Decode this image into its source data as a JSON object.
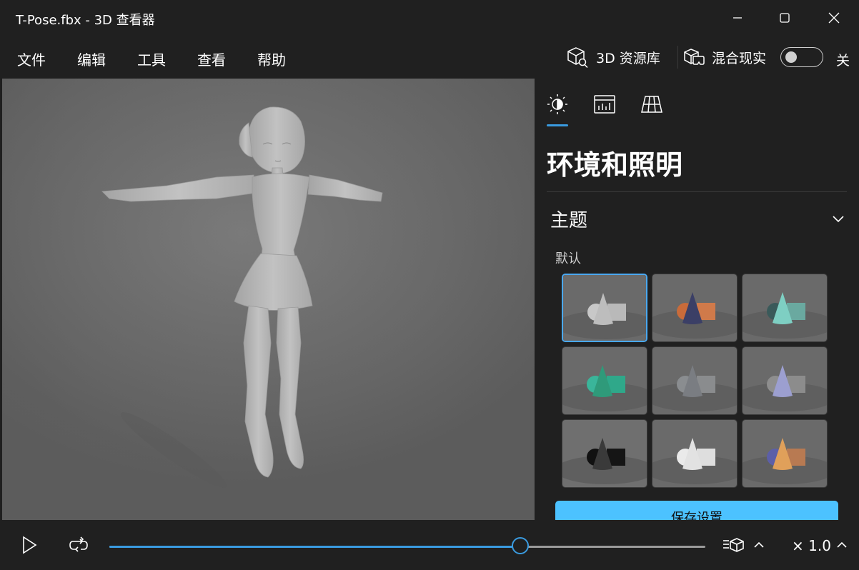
{
  "window": {
    "title": "T-Pose.fbx - 3D 查看器",
    "controls": [
      "minimize-icon",
      "maximize-icon",
      "close-icon"
    ]
  },
  "menu": {
    "items": [
      {
        "label": "文件"
      },
      {
        "label": "编辑"
      },
      {
        "label": "工具"
      },
      {
        "label": "查看"
      },
      {
        "label": "帮助"
      }
    ],
    "library_label": "3D 资源库",
    "mixed_reality_label": "混合现实",
    "toggle_state": "关"
  },
  "panel": {
    "tabs": [
      {
        "icon": "sun-icon",
        "selected": true
      },
      {
        "icon": "stats-icon",
        "selected": false
      },
      {
        "icon": "grid-icon",
        "selected": false
      }
    ],
    "title": "环境和照明",
    "section": "主题",
    "sub_label": "默认",
    "themes": [
      {
        "index": 0,
        "selected": true,
        "cone": "#bdbdbd",
        "sphere": "#c8c8c8",
        "cube": "#b9b9b9"
      },
      {
        "index": 1,
        "selected": false,
        "cone": "#3b3f66",
        "sphere": "#c96b3a",
        "cube": "#d07a4a"
      },
      {
        "index": 2,
        "selected": false,
        "cone": "#7ecfc3",
        "sphere": "#3a5a5a",
        "cube": "#6aa9a0"
      },
      {
        "index": 3,
        "selected": false,
        "cone": "#2f9a7a",
        "sphere": "#3ab59a",
        "cube": "#2fa88a"
      },
      {
        "index": 4,
        "selected": false,
        "cone": "#7a7d82",
        "sphere": "#8a8d90",
        "cube": "#8a8c8e"
      },
      {
        "index": 5,
        "selected": false,
        "cone": "#9c9fd0",
        "sphere": "#8e8e8e",
        "cube": "#8c8c8c"
      },
      {
        "index": 6,
        "selected": false,
        "cone": "#3a3a3a",
        "sphere": "#111111",
        "cube": "#151515"
      },
      {
        "index": 7,
        "selected": false,
        "cone": "#e2e2e2",
        "sphere": "#eaeaea",
        "cube": "#dedede"
      },
      {
        "index": 8,
        "selected": false,
        "cone": "#e0a05a",
        "sphere": "#5c5fa8",
        "cube": "#b87a52"
      }
    ],
    "save_label": "保存设置"
  },
  "playback": {
    "progress": 0.69,
    "speed_label": "× 1.0"
  },
  "colors": {
    "accent": "#3a9be0",
    "button": "#4cc2ff",
    "chrome": "#202020"
  }
}
